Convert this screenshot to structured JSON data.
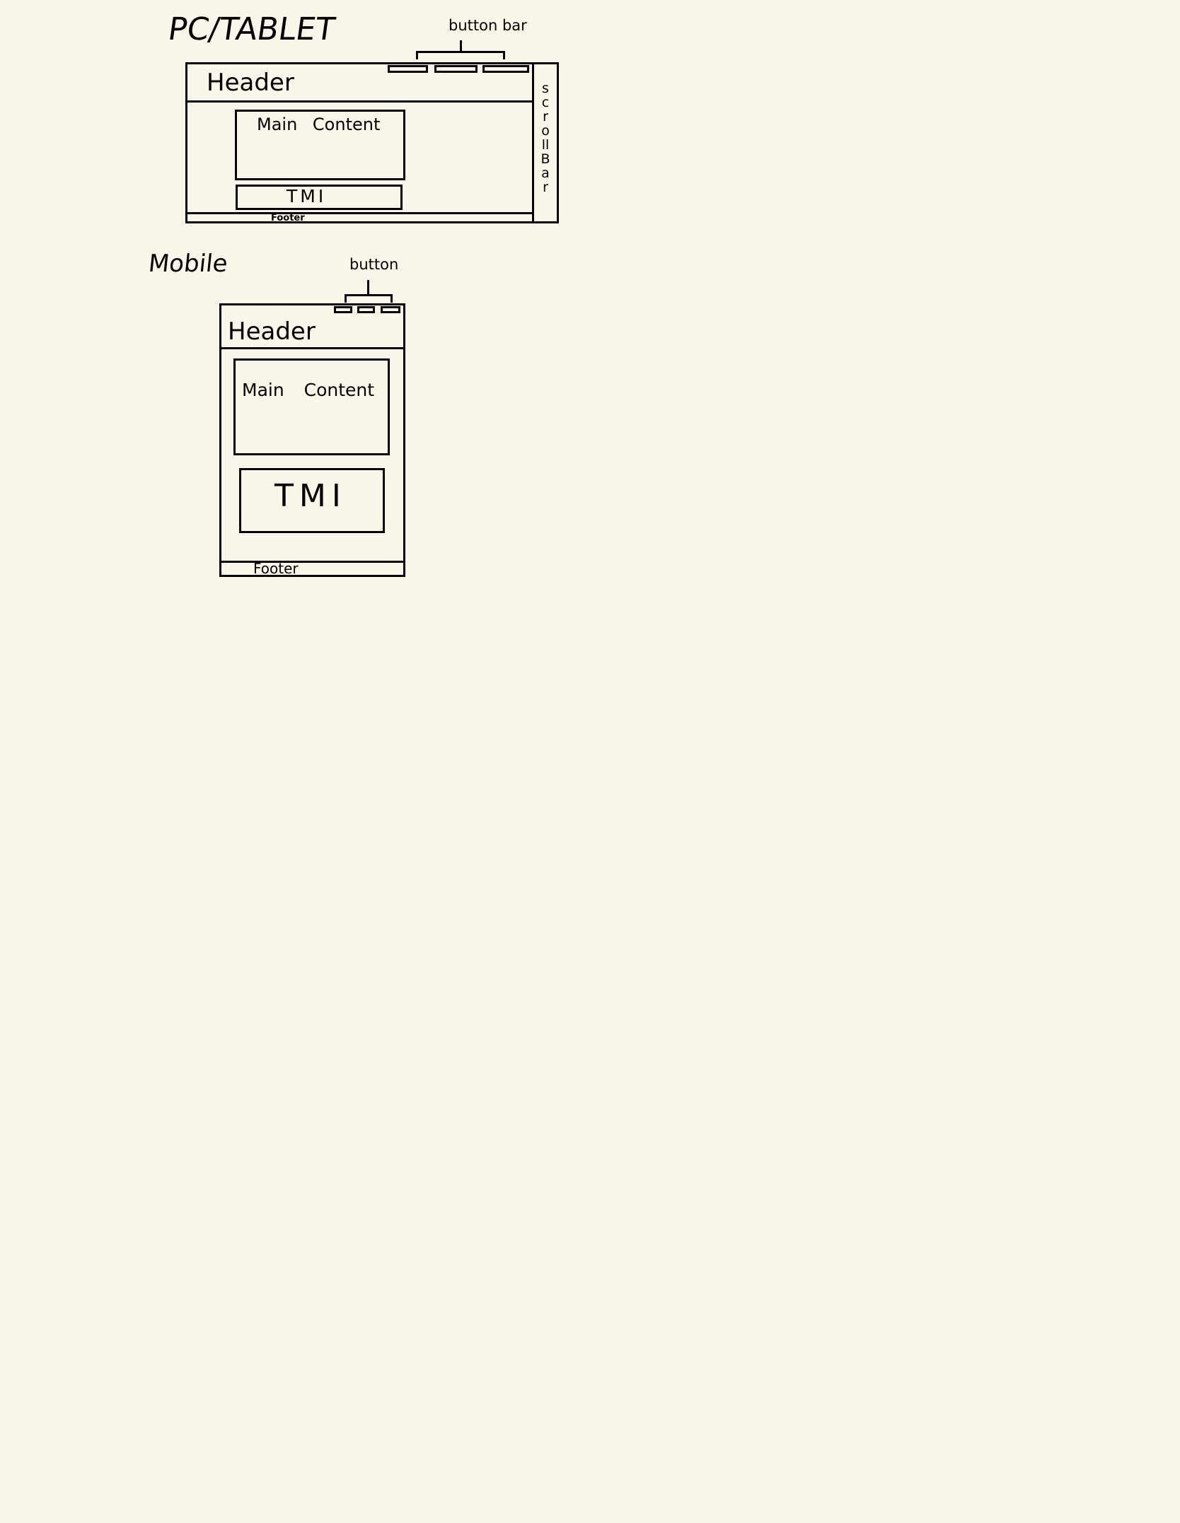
{
  "pc_tablet": {
    "title": "PC/TABLET",
    "button_bar_label": "button bar",
    "header_label": "Header",
    "main_content_label": "Main Content",
    "tmi_label": "TMI",
    "footer_label": "Footer",
    "scrollbar_label": "scroll Bar",
    "scrollbar_letters": [
      "s",
      "c",
      "r",
      "o",
      "l",
      "l",
      "B",
      "a",
      "r"
    ],
    "button_count": 3
  },
  "mobile": {
    "title": "Mobile",
    "button_label": "button",
    "header_label": "Header",
    "main_content_label": "Main Content",
    "tmi_label": "TMI",
    "footer_label": "Footer",
    "button_count": 3
  },
  "colors": {
    "background": "#f8f5e9",
    "ink": "#000000"
  }
}
